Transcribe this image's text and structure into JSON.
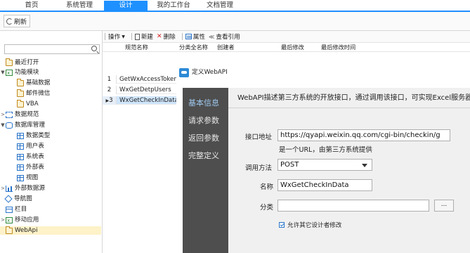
{
  "menu": {
    "items": [
      {
        "label": "首页"
      },
      {
        "label": "系统管理"
      },
      {
        "label": "设计"
      },
      {
        "label": "我的工作台"
      },
      {
        "label": "文档管理"
      }
    ],
    "active_index": 2
  },
  "toolbar1": {
    "refresh_label": "刷新"
  },
  "search": {
    "value": ""
  },
  "tree": {
    "items": [
      {
        "label": "最近打开",
        "icon": "folder-icon"
      },
      {
        "label": "功能模块",
        "icon": "module-icon"
      },
      {
        "label": "基础数据",
        "icon": "folder-icon"
      },
      {
        "label": "邮件微信",
        "icon": "folder-icon"
      },
      {
        "label": "VBA",
        "icon": "folder-icon"
      },
      {
        "label": "数据规范",
        "icon": "spec-icon"
      },
      {
        "label": "数据库管理",
        "icon": "database-icon"
      },
      {
        "label": "数据类型",
        "icon": "table-icon"
      },
      {
        "label": "用户表",
        "icon": "table-icon"
      },
      {
        "label": "系统表",
        "icon": "table-icon"
      },
      {
        "label": "外部表",
        "icon": "table-icon"
      },
      {
        "label": "视图",
        "icon": "view-icon"
      },
      {
        "label": "外部数据源",
        "icon": "datasource-icon"
      },
      {
        "label": "导航图",
        "icon": "navigation-icon"
      },
      {
        "label": "栏目",
        "icon": "column-icon"
      },
      {
        "label": "移动应用",
        "icon": "mobile-icon"
      },
      {
        "label": "WebApi",
        "icon": "folder-icon"
      }
    ],
    "selected": "WebApi"
  },
  "toolbar2": {
    "operate_label": "操作",
    "new_label": "新建",
    "delete_label": "删除",
    "property_label": "属性",
    "reference_label": "查看引用"
  },
  "grid": {
    "columns": [
      "规范名称",
      "分类全名称",
      "创建者",
      "最后修改",
      "最后修改时间"
    ],
    "rows": [
      {
        "num": "1",
        "name": "GetWxAccessToken"
      },
      {
        "num": "2",
        "name": "WxGetDetpUsers"
      },
      {
        "num": "3",
        "name": "WxGetCheckInData"
      }
    ],
    "selected_row": 3
  },
  "dialog": {
    "title": "定义WebAPI",
    "sidebar": [
      "基本信息",
      "请求参数",
      "返回参数",
      "完整定义"
    ],
    "active_tab": 0,
    "description": "WebAPI描述第三方系统的开放接口，通过调用该接口，可实现Excel服务器",
    "fields": {
      "url_label": "接口地址",
      "url_value": "https://qyapi.weixin.qq.com/cgi-bin/checkin/g",
      "url_hint": "是一个URL，由第三方系统提供",
      "method_label": "调用方法",
      "method_value": "POST",
      "name_label": "名称",
      "name_value": "WxGetCheckInData",
      "category_label": "分类",
      "category_value": "",
      "browse_label": "...",
      "allow_edit_label": "允许其它设计者修改",
      "allow_edit_checked": true
    }
  }
}
